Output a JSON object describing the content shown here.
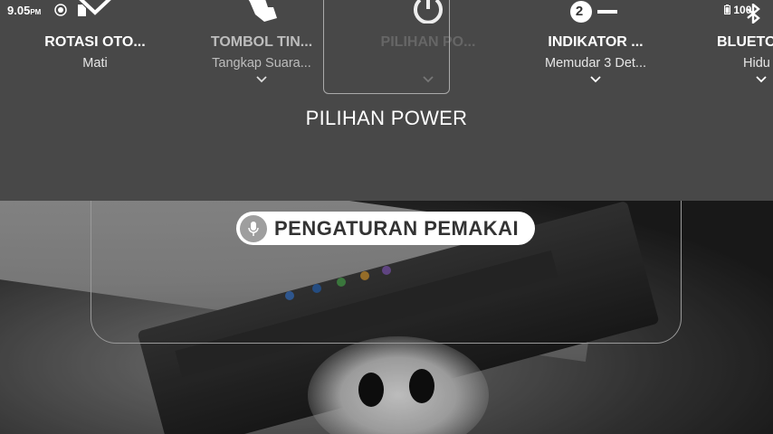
{
  "status_bar": {
    "time": "9.05",
    "ampm": "PM",
    "battery": "100"
  },
  "tiles": [
    {
      "title": "ROTASI OTO...",
      "subtitle": "Mati",
      "icon": "screen-rotate-icon"
    },
    {
      "title": "TOMBOL TIN...",
      "subtitle": "Tangkap Suara...",
      "icon": "touch-gesture-icon"
    },
    {
      "title": "PILIHAN PO...",
      "subtitle": "",
      "icon": "power-icon"
    },
    {
      "title": "INDIKATOR ...",
      "subtitle": "Memudar 3 Det...",
      "icon": "indicator-icon"
    },
    {
      "title": "BLUETO",
      "subtitle": "Hidu",
      "icon": "bluetooth-icon"
    }
  ],
  "indicator_badge": "2",
  "section_title": "PILIHAN POWER",
  "voice_input": {
    "label": "PENGATURAN PEMAKAI",
    "icon": "microphone-icon"
  },
  "colors": {
    "panel": "#484848",
    "pill": "#ffffff",
    "mic": "#9e9e9e"
  }
}
